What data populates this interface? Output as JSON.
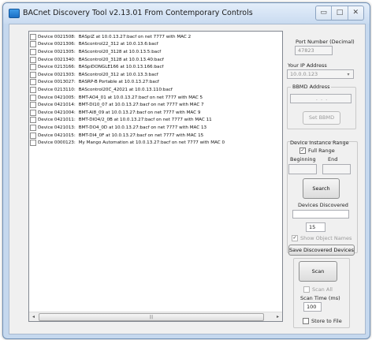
{
  "window": {
    "title": "BACnet Discovery Tool v2.13.01 From Contemporary Controls",
    "minimize_glyph": "▭",
    "maximize_glyph": "□",
    "close_glyph": "✕"
  },
  "devices": [
    {
      "id": "Device 0021508:",
      "desc": "BASpiZ at 10.0.13.27:bacf on net 7777 with MAC 2"
    },
    {
      "id": "Device 0021306:",
      "desc": "BAScontrol22_312 at 10.0.13.6:bacf"
    },
    {
      "id": "Device 0021305:",
      "desc": "BAScontrol20_3128 at 10.0.13.5:bacf"
    },
    {
      "id": "Device 0021340:",
      "desc": "BAScontrol20_3128 at 10.0.13.40:bacf"
    },
    {
      "id": "Device 0213166:",
      "desc": "BASpiDONGLE166 at 10.0.13.166:bacf"
    },
    {
      "id": "Device 0021303:",
      "desc": "BAScontrol20_312 at 10.0.13.3:bacf"
    },
    {
      "id": "Device 0013027:",
      "desc": "BASRP-B Portable at 10.0.13.27:bacf"
    },
    {
      "id": "Device 0213110:",
      "desc": "BAScontrol20C_42021 at 10.0.13.110:bacf"
    },
    {
      "id": "Device 0421005:",
      "desc": "BMT-AO4_01 at 10.0.13.27:bacf on net 7777 with MAC 5"
    },
    {
      "id": "Device 0421014:",
      "desc": "BMT-DI10_07 at 10.0.13.27:bacf on net 7777 with MAC 7"
    },
    {
      "id": "Device 0421004:",
      "desc": "BMT-AI8_09 at 10.0.13.27:bacf on net 7777 with MAC 9"
    },
    {
      "id": "Device 0421011:",
      "desc": "BMT-DIO4/2_0B at 10.0.13.27:bacf on net 7777 with MAC 11"
    },
    {
      "id": "Device 0421013:",
      "desc": "BMT-DO4_0D at 10.0.13.27:bacf on net 7777 with MAC 13"
    },
    {
      "id": "Device 0421015:",
      "desc": "BMT-DI4_0F at 10.0.13.27:bacf on net 7777 with MAC 15"
    },
    {
      "id": "Device 0000123:",
      "desc": "My Mango Automation at 10.0.13.27:bacf on net 7777 with MAC 0"
    }
  ],
  "scroll": {
    "left_glyph": "◂",
    "right_glyph": "▸",
    "thumb_grip": "|||"
  },
  "port": {
    "label": "Port Number (Decimal)",
    "value": "47823"
  },
  "ip": {
    "label": "Your IP Address",
    "value": "10.0.0.123",
    "dropdown_glyph": "▾"
  },
  "bbmd": {
    "label": "BBMD Address",
    "value": ".   .   .",
    "button": "Set BBMD"
  },
  "range": {
    "label": "Device Instance Range",
    "full_range": "Full Range",
    "full_range_mark": "✓",
    "beginning": "Beginning",
    "end": "End",
    "search_button": "Search"
  },
  "discovered": {
    "label": "Devices Discovered",
    "count": "15"
  },
  "show_names": {
    "label": "Show Object Names",
    "mark": "✓"
  },
  "save_button": "Save Discovered Devices",
  "scan": {
    "button": "Scan",
    "scan_all": "Scan All",
    "time_label": "Scan Time (ms)",
    "time_value": "100",
    "store": "Store to File"
  }
}
